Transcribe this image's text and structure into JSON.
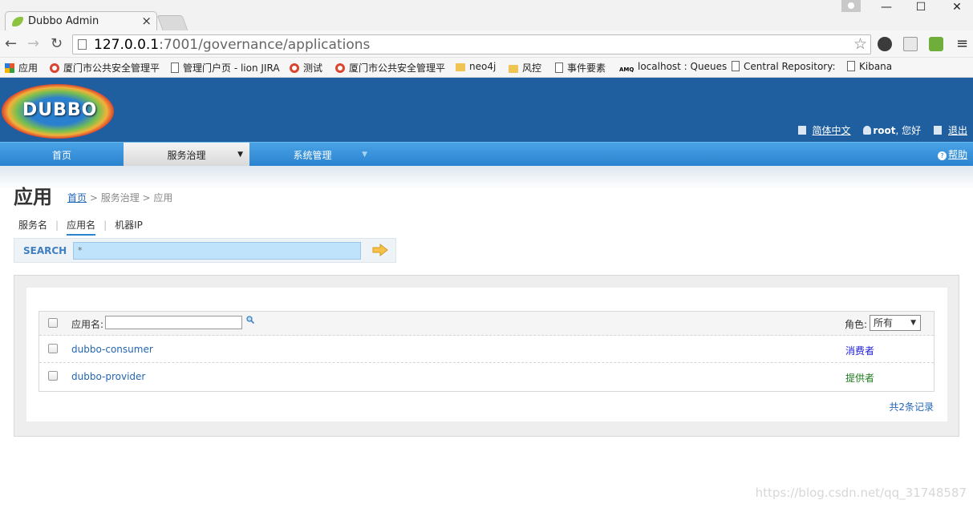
{
  "browser": {
    "tab_title": "Dubbo Admin",
    "url_host": "127.0.0.1",
    "url_rest": ":7001/governance/applications",
    "win_min": "—",
    "win_max": "☐",
    "win_close": "✕",
    "tab_close": "×"
  },
  "bookmarks": [
    {
      "label": "应用",
      "icon": "apps-icon"
    },
    {
      "label": "厦门市公共安全管理平",
      "icon": "red-circle-icon"
    },
    {
      "label": "管理门户页 - lion JIRA",
      "icon": "page-icon"
    },
    {
      "label": "测试",
      "icon": "red-circle-icon"
    },
    {
      "label": "厦门市公共安全管理平",
      "icon": "red-circle-icon"
    },
    {
      "label": "neo4j",
      "icon": "folder-icon"
    },
    {
      "label": "风控",
      "icon": "folder-icon"
    },
    {
      "label": "事件要素",
      "icon": "page-icon"
    },
    {
      "label": "localhost : Queues",
      "icon": "amq-icon"
    },
    {
      "label": "Central Repository:",
      "icon": "page-icon"
    },
    {
      "label": "Kibana",
      "icon": "page-icon"
    }
  ],
  "header": {
    "logo_text": "DUBBO",
    "lang": "简体中文",
    "user": "root",
    "greeting": ", 您好",
    "logout": "退出"
  },
  "menu": {
    "home": "首页",
    "service_gov": "服务治理",
    "sys_mgmt": "系统管理",
    "help": "帮助"
  },
  "page": {
    "title": "应用",
    "crumb_home": "首页",
    "crumb_rest": " > 服务治理 > 应用"
  },
  "subtabs": [
    "服务名",
    "应用名",
    "机器IP"
  ],
  "search": {
    "label": "SEARCH",
    "value": "*"
  },
  "table": {
    "name_header": "应用名:",
    "role_header": "角色:",
    "role_selected": "所有",
    "rows": [
      {
        "name": "dubbo-consumer",
        "role": "消费者",
        "role_color": "#1a1adf"
      },
      {
        "name": "dubbo-provider",
        "role": "提供者",
        "role_color": "#1b7a1b"
      }
    ],
    "count": "共2条记录"
  },
  "watermark": "https://blog.csdn.net/qq_31748587"
}
